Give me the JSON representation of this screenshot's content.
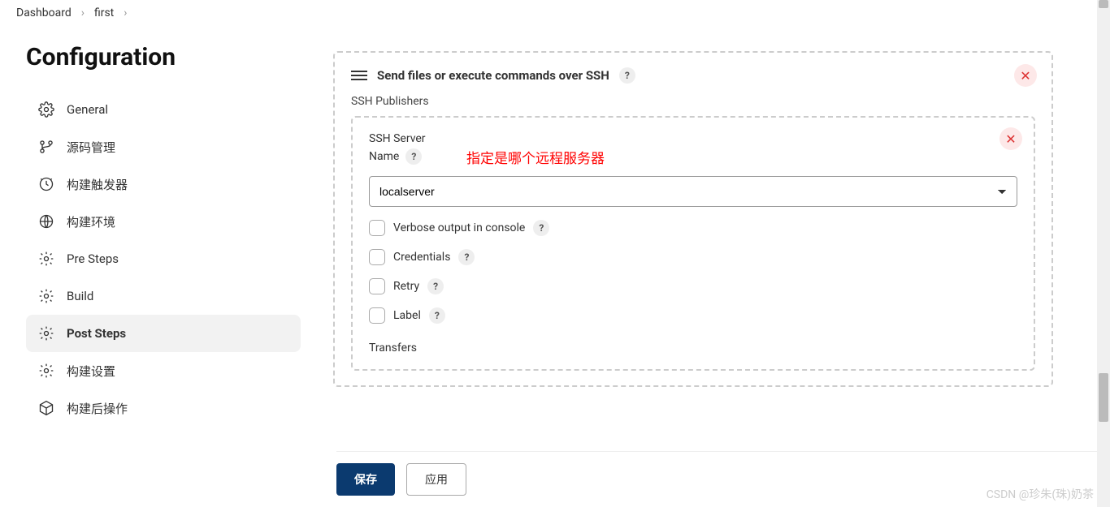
{
  "breadcrumb": {
    "items": [
      "Dashboard",
      "first"
    ]
  },
  "page": {
    "title": "Configuration"
  },
  "sidebar": {
    "items": [
      {
        "label": "General",
        "icon": "gear-icon"
      },
      {
        "label": "源码管理",
        "icon": "branch-icon"
      },
      {
        "label": "构建触发器",
        "icon": "clock-icon"
      },
      {
        "label": "构建环境",
        "icon": "globe-icon"
      },
      {
        "label": "Pre Steps",
        "icon": "gear-icon"
      },
      {
        "label": "Build",
        "icon": "gear-icon"
      },
      {
        "label": "Post Steps",
        "icon": "gear-icon"
      },
      {
        "label": "构建设置",
        "icon": "gear-icon"
      },
      {
        "label": "构建后操作",
        "icon": "box-icon"
      }
    ],
    "active_index": 6
  },
  "panel": {
    "title": "Send files or execute commands over SSH",
    "subtitle": "SSH Publishers",
    "server": {
      "section_label": "SSH Server",
      "field_label": "Name",
      "annotation": "指定是哪个远程服务器",
      "selected": "localserver"
    },
    "checkboxes": [
      {
        "label": "Verbose output in console"
      },
      {
        "label": "Credentials"
      },
      {
        "label": "Retry"
      },
      {
        "label": "Label"
      }
    ],
    "transfers_label": "Transfers"
  },
  "footer": {
    "save": "保存",
    "apply": "应用"
  },
  "watermark": "CSDN @珍朱(珠)奶茶"
}
